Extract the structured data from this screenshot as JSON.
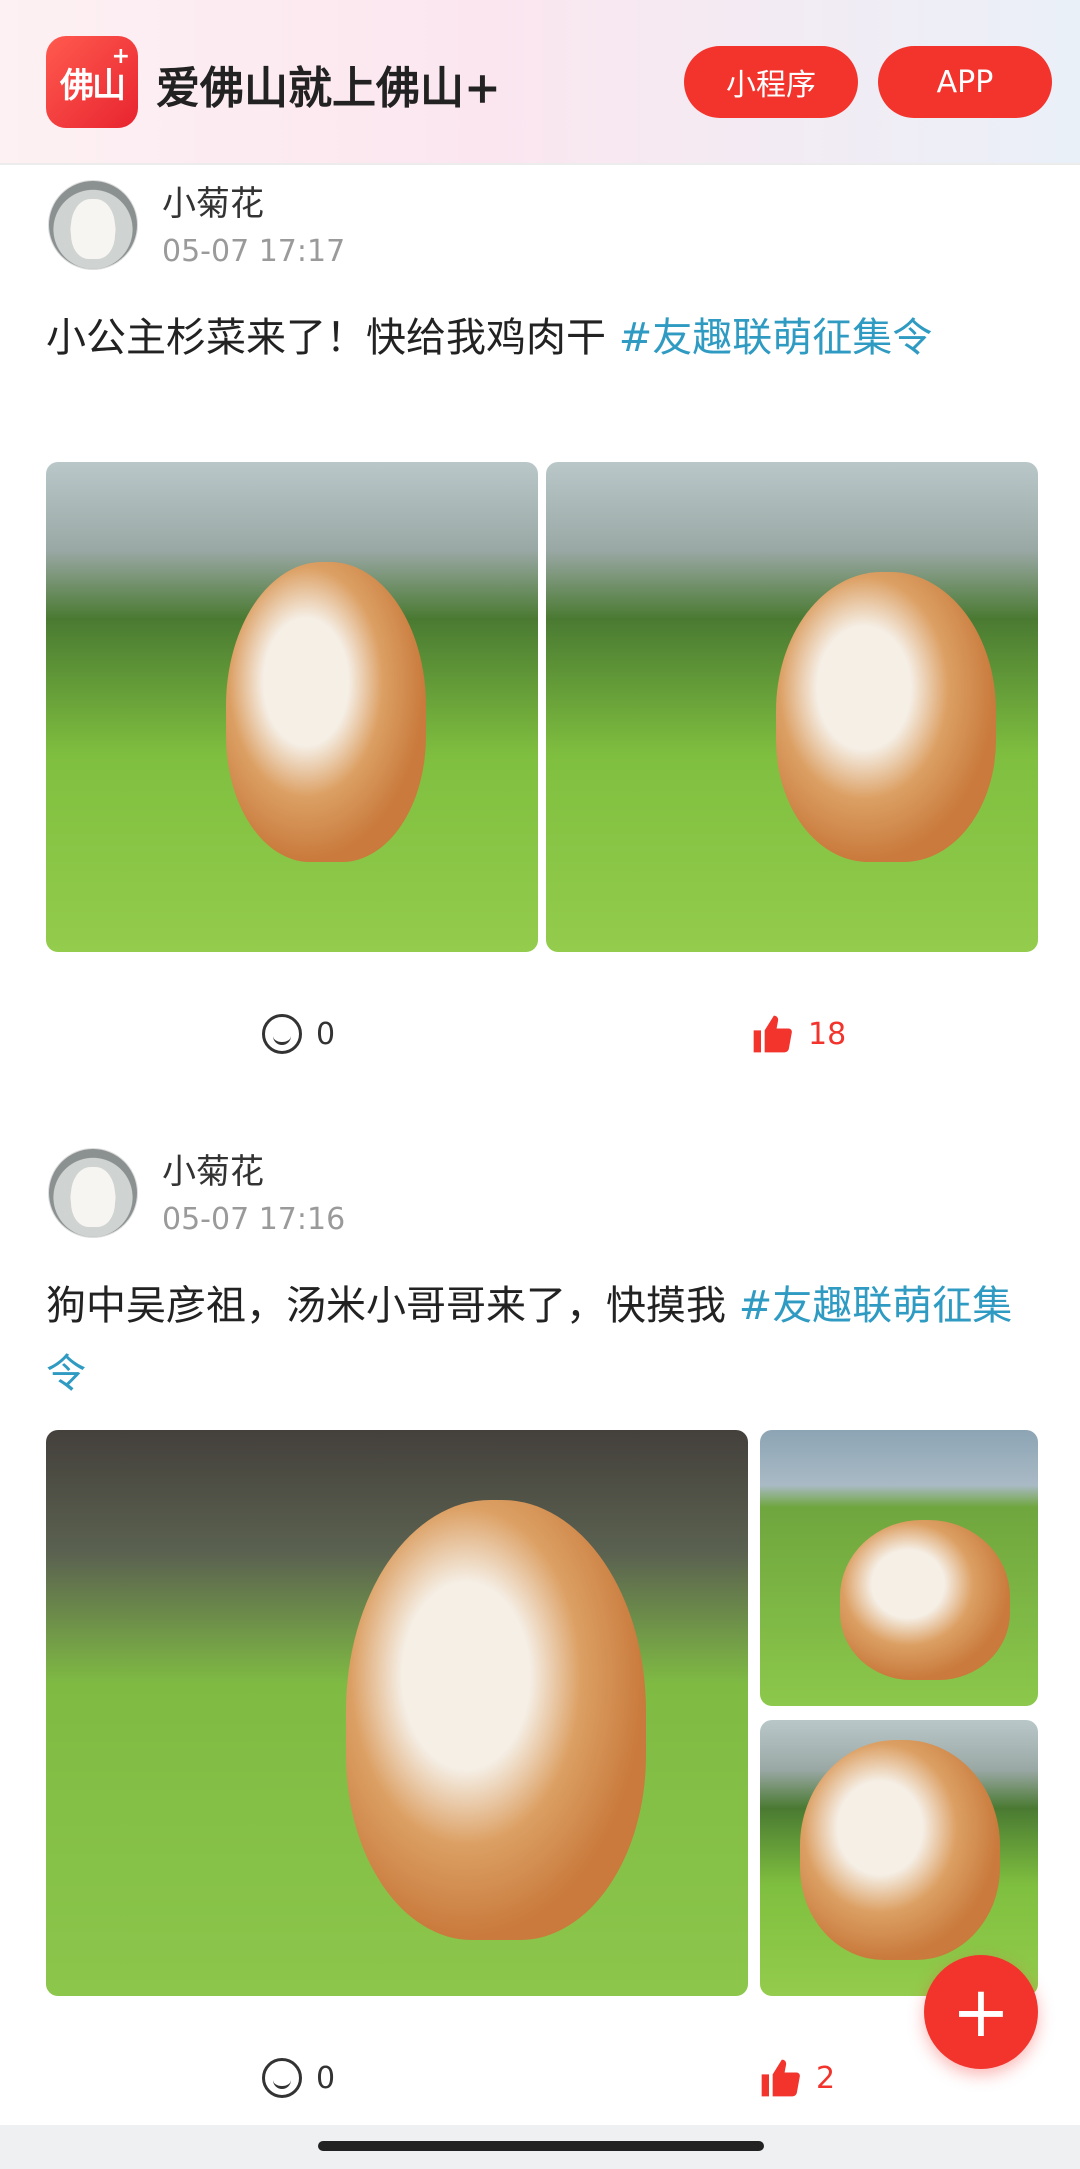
{
  "header": {
    "logo_text": "佛山",
    "logo_plus": "+",
    "title": "爱佛山就上佛山+",
    "mini_program_label": "小程序",
    "app_label": "APP"
  },
  "posts": [
    {
      "author": "小菊花",
      "time": "05-07 17:17",
      "text": "小公主杉菜来了！快给我鸡肉干 ",
      "tag": "#友趣联萌征集令",
      "comments": "0",
      "likes": "18"
    },
    {
      "author": "小菊花",
      "time": "05-07 17:16",
      "text": "狗中吴彦祖，汤米小哥哥来了，快摸我 ",
      "tag": "#友趣联萌征集令",
      "comments": "0",
      "likes": "2"
    }
  ],
  "fab_label": "+",
  "colors": {
    "accent": "#f2342d",
    "tag": "#2f9bc2",
    "muted": "#9a9a9a"
  },
  "icons": [
    "comment-icon",
    "thumbs-up-icon",
    "plus-icon"
  ]
}
